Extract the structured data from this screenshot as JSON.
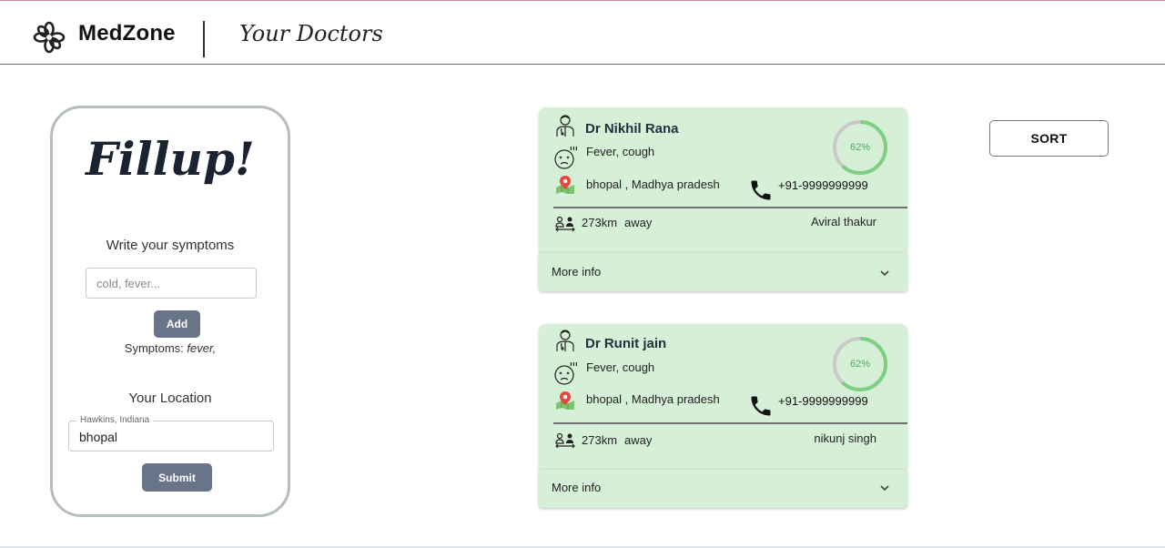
{
  "header": {
    "brand": "MedZone",
    "page_heading": "Your Doctors"
  },
  "fillup": {
    "title": "Fillup!",
    "symptoms_label": "Write your symptoms",
    "symptoms_placeholder": "cold, fever...",
    "add_button": "Add",
    "symptoms_prefix": "Symptoms:",
    "symptoms_value": "fever,",
    "location_label": "Your Location",
    "location_legend": "Hawkins, Indiana",
    "location_value": "bhopal",
    "submit_button": "Submit"
  },
  "sort_button": "SORT",
  "doctors": [
    {
      "name": "Dr Nikhil Rana",
      "symptoms": "Fever, cough",
      "address": "bhopal , Madhya pradesh",
      "phone": "+91-9999999999",
      "match_label": "62%",
      "match_fraction": 0.62,
      "distance": "273km",
      "away": "away",
      "patient": "Aviral thakur",
      "more_info": "More info"
    },
    {
      "name": "Dr Runit jain",
      "symptoms": "Fever, cough",
      "address": "bhopal , Madhya pradesh",
      "phone": "+91-9999999999",
      "match_label": "62%",
      "match_fraction": 0.62,
      "distance": "273km",
      "away": "away",
      "patient": "nikunj singh",
      "more_info": "More info"
    }
  ],
  "colors": {
    "card_bg": "#d6efd7",
    "gauge_fill": "#7dcf83",
    "gauge_track": "#c9c9c9",
    "button_bg": "#6a7489"
  },
  "icons": {
    "logo": "asterisk-flower-icon",
    "doctor": "doctor-icon",
    "sick": "sick-face-icon",
    "location": "map-pin-icon",
    "phone": "phone-icon",
    "distance": "people-distance-icon",
    "expand": "chevron-down-icon"
  }
}
